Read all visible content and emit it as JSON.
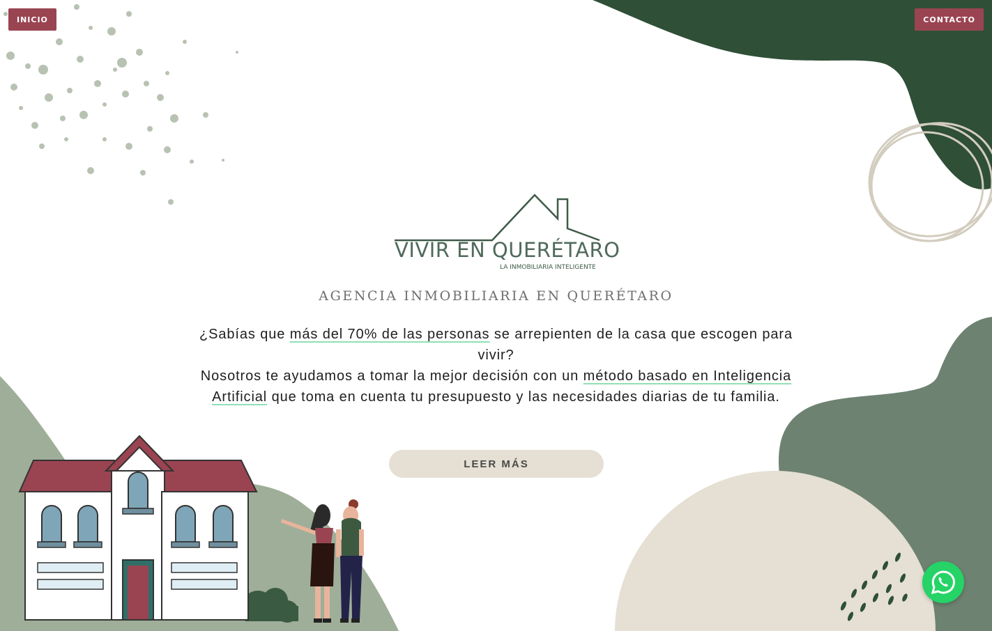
{
  "nav": {
    "home_label": "INICIO",
    "contact_label": "CONTACTO"
  },
  "brand": {
    "name": "VIVIR EN QUERÉTARO",
    "tagline": "LA INMOBILIARIA INTELIGENTE"
  },
  "hero": {
    "subtitle": "AGENCIA INMOBILIARIA EN QUERÉTARO",
    "p1_a": "¿Sabías que ",
    "p1_hl": "más del 70% de las personas",
    "p1_b": " se arrepienten de la casa que escogen para vivir?",
    "p2_a": "Nosotros te ayudamos a tomar la mejor decisión con un ",
    "p2_hl": "método basado en Inteligencia Artificial",
    "p2_b": " que toma en cuenta tu presupuesto y las necesidades diarias de tu familia.",
    "cta_label": "LEER MÁS"
  },
  "icons": {
    "whatsapp": "whatsapp-icon"
  },
  "colors": {
    "primary_red": "#9a4452",
    "dark_green": "#2f4f37",
    "sage_green": "#6e8271",
    "light_sage": "#9fae98",
    "beige": "#e5e0d3",
    "whatsapp": "#25d366"
  }
}
